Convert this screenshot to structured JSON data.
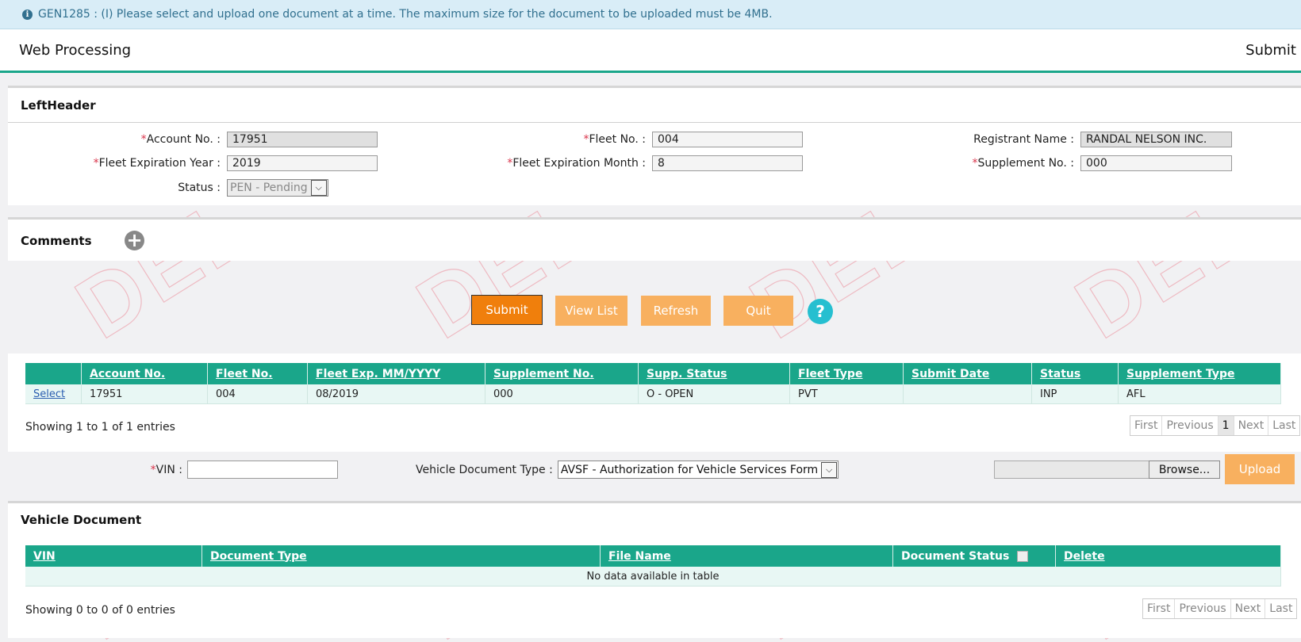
{
  "alert": {
    "message": "GEN1285 : (I) Please select and upload one document at a time. The maximum size for the document to be uploaded must be 4MB."
  },
  "header": {
    "title": "Web Processing",
    "submit_link": "Submit"
  },
  "left_header": {
    "heading": "LeftHeader",
    "account_no_label": "Account No. :",
    "account_no_value": "17951",
    "fleet_no_label": "Fleet No. :",
    "fleet_no_value": "004",
    "registrant_name_label": "Registrant Name :",
    "registrant_name_value": "RANDAL NELSON INC.",
    "fleet_exp_year_label": "Fleet Expiration Year :",
    "fleet_exp_year_value": "2019",
    "fleet_exp_month_label": "Fleet Expiration Month :",
    "fleet_exp_month_value": "8",
    "supplement_no_label": "Supplement No. :",
    "supplement_no_value": "000",
    "status_label": "Status :",
    "status_value": "PEN - Pending",
    "required_mark": "*"
  },
  "comments": {
    "heading": "Comments",
    "add_icon": "plus-circle-icon"
  },
  "actions": {
    "submit": "Submit",
    "view_list": "View List",
    "refresh": "Refresh",
    "quit": "Quit",
    "help": "?"
  },
  "supplement_table": {
    "columns": [
      "",
      "Account No.",
      "Fleet No.",
      "Fleet Exp. MM/YYYY",
      "Supplement No.",
      "Supp. Status",
      "Fleet Type",
      "Submit Date",
      "Status",
      "Supplement Type"
    ],
    "rows": [
      [
        "Select",
        "17951",
        "004",
        "08/2019",
        "000",
        "O - OPEN",
        "PVT",
        "",
        "INP",
        "AFL"
      ]
    ],
    "info": "Showing 1 to 1 of 1 entries",
    "pager": {
      "first": "First",
      "previous": "Previous",
      "page": "1",
      "next": "Next",
      "last": "Last"
    }
  },
  "upload": {
    "vin_label": "VIN :",
    "vin_value": "",
    "doc_type_label": "Vehicle Document Type :",
    "doc_type_value": "AVSF - Authorization for Vehicle Services Form",
    "browse": "Browse...",
    "upload": "Upload"
  },
  "vehicle_document": {
    "heading": "Vehicle Document",
    "columns": [
      "VIN",
      "Document Type",
      "File Name",
      "Document Status",
      "Delete"
    ],
    "empty": "No data available in table",
    "info": "Showing 0 to 0 of 0 entries",
    "pager": {
      "first": "First",
      "previous": "Previous",
      "next": "Next",
      "last": "Last"
    }
  },
  "colors": {
    "accent": "#1aa68a",
    "button_primary": "#f07f0c",
    "button_light": "#f8b05f",
    "help": "#26bfd0"
  }
}
